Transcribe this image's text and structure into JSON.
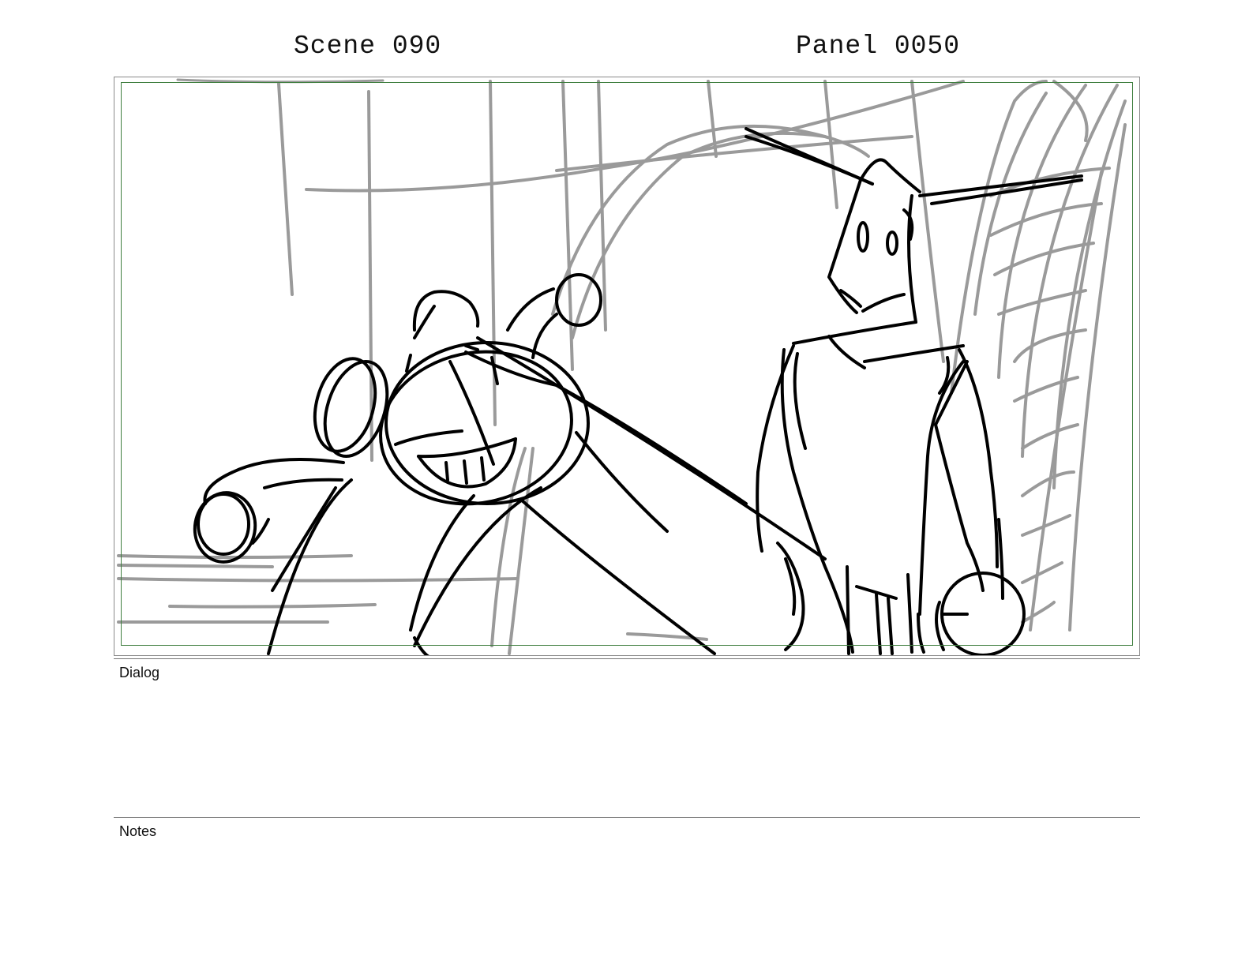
{
  "header": {
    "scene": "Scene 090",
    "panel": "Panel 0050"
  },
  "sections": {
    "dialog_label": "Dialog",
    "dialog_text": "",
    "notes_label": "Notes",
    "notes_text": ""
  },
  "colors": {
    "sketch_line": "#000000",
    "background_sketch": "#9a9a9a",
    "safe_area_border": "#3f7f3f",
    "frame_border": "#8a8a8a"
  }
}
